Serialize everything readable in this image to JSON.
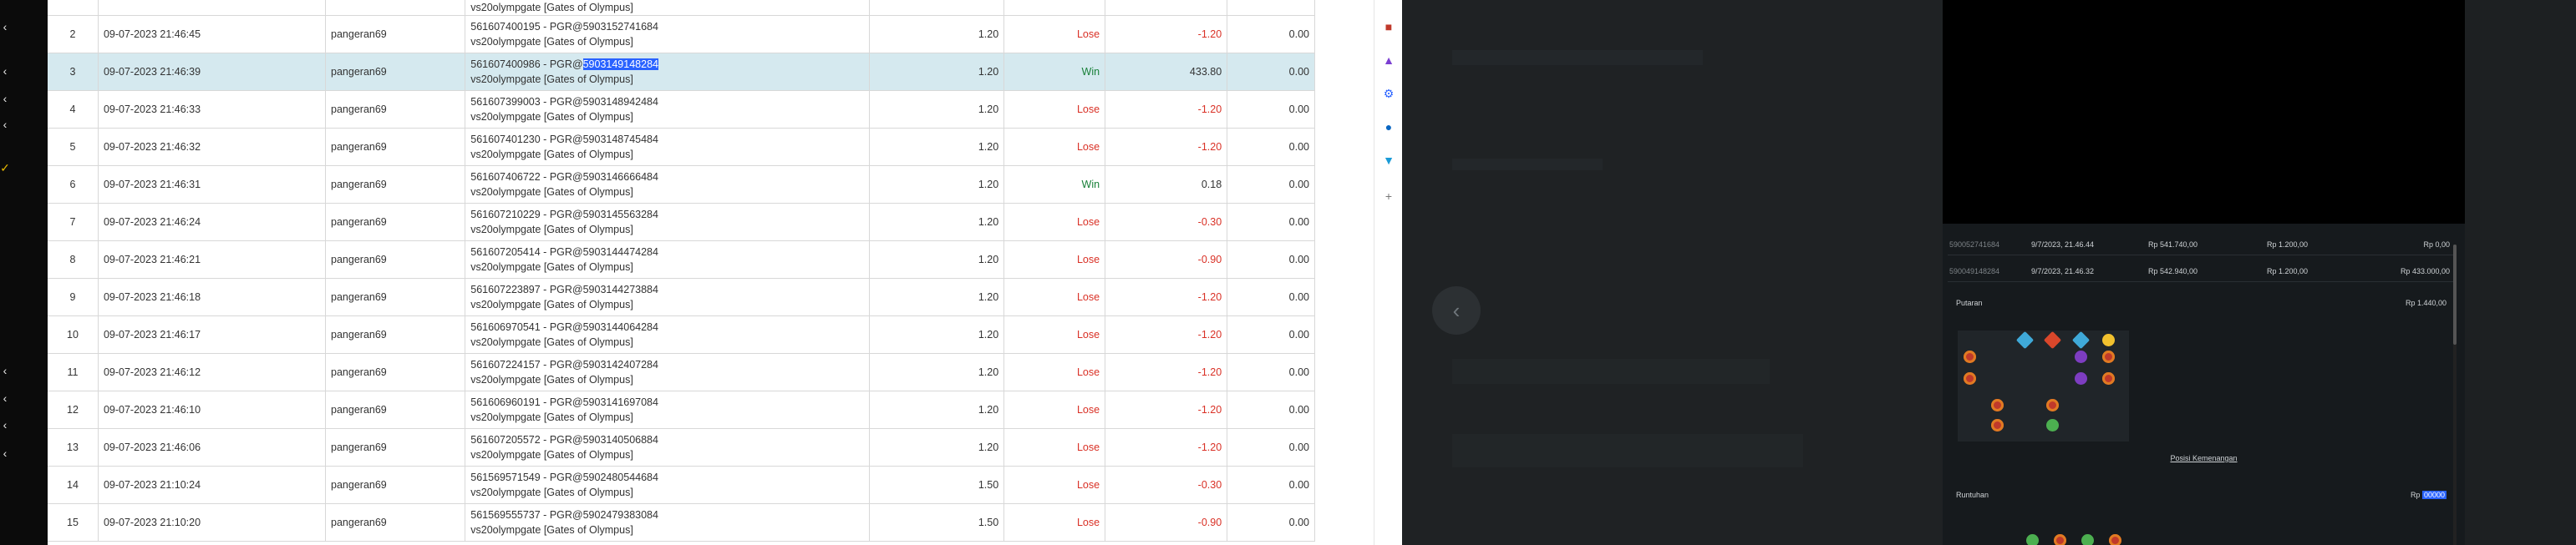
{
  "rows": [
    {
      "no": "",
      "date": "",
      "user": "",
      "game1": "vs20olympgate [Gates of Olympus]",
      "game2": "",
      "bet": "",
      "result": "",
      "win": "",
      "jp": "",
      "partial": true
    },
    {
      "no": "2",
      "date": "09-07-2023 21:46:45",
      "user": "pangeran69",
      "game1": "561607400195 - PGR@5903152741684",
      "game2": "vs20olympgate [Gates of Olympus]",
      "bet": "1.20",
      "result": "Lose",
      "win": "-1.20",
      "jp": "0.00"
    },
    {
      "no": "3",
      "date": "09-07-2023 21:46:39",
      "user": "pangeran69",
      "game1": "561607400986 - PGR@",
      "game1_hl": "5903149148284",
      "game2": "vs20olympgate [Gates of Olympus]",
      "bet": "1.20",
      "result": "Win",
      "win": "433.80",
      "jp": "0.00",
      "selected": true
    },
    {
      "no": "4",
      "date": "09-07-2023 21:46:33",
      "user": "pangeran69",
      "game1": "561607399003 - PGR@5903148942484",
      "game2": "vs20olympgate [Gates of Olympus]",
      "bet": "1.20",
      "result": "Lose",
      "win": "-1.20",
      "jp": "0.00"
    },
    {
      "no": "5",
      "date": "09-07-2023 21:46:32",
      "user": "pangeran69",
      "game1": "561607401230 - PGR@5903148745484",
      "game2": "vs20olympgate [Gates of Olympus]",
      "bet": "1.20",
      "result": "Lose",
      "win": "-1.20",
      "jp": "0.00"
    },
    {
      "no": "6",
      "date": "09-07-2023 21:46:31",
      "user": "pangeran69",
      "game1": "561607406722 - PGR@5903146666484",
      "game2": "vs20olympgate [Gates of Olympus]",
      "bet": "1.20",
      "result": "Win",
      "win": "0.18",
      "jp": "0.00"
    },
    {
      "no": "7",
      "date": "09-07-2023 21:46:24",
      "user": "pangeran69",
      "game1": "561607210229 - PGR@5903145563284",
      "game2": "vs20olympgate [Gates of Olympus]",
      "bet": "1.20",
      "result": "Lose",
      "win": "-0.30",
      "jp": "0.00"
    },
    {
      "no": "8",
      "date": "09-07-2023 21:46:21",
      "user": "pangeran69",
      "game1": "561607205414 - PGR@5903144474284",
      "game2": "vs20olympgate [Gates of Olympus]",
      "bet": "1.20",
      "result": "Lose",
      "win": "-0.90",
      "jp": "0.00"
    },
    {
      "no": "9",
      "date": "09-07-2023 21:46:18",
      "user": "pangeran69",
      "game1": "561607223897 - PGR@5903144273884",
      "game2": "vs20olympgate [Gates of Olympus]",
      "bet": "1.20",
      "result": "Lose",
      "win": "-1.20",
      "jp": "0.00"
    },
    {
      "no": "10",
      "date": "09-07-2023 21:46:17",
      "user": "pangeran69",
      "game1": "561606970541 - PGR@5903144064284",
      "game2": "vs20olympgate [Gates of Olympus]",
      "bet": "1.20",
      "result": "Lose",
      "win": "-1.20",
      "jp": "0.00"
    },
    {
      "no": "11",
      "date": "09-07-2023 21:46:12",
      "user": "pangeran69",
      "game1": "561607224157 - PGR@5903142407284",
      "game2": "vs20olympgate [Gates of Olympus]",
      "bet": "1.20",
      "result": "Lose",
      "win": "-1.20",
      "jp": "0.00"
    },
    {
      "no": "12",
      "date": "09-07-2023 21:46:10",
      "user": "pangeran69",
      "game1": "561606960191 - PGR@5903141697084",
      "game2": "vs20olympgate [Gates of Olympus]",
      "bet": "1.20",
      "result": "Lose",
      "win": "-1.20",
      "jp": "0.00"
    },
    {
      "no": "13",
      "date": "09-07-2023 21:46:06",
      "user": "pangeran69",
      "game1": "561607205572 - PGR@5903140506884",
      "game2": "vs20olympgate [Gates of Olympus]",
      "bet": "1.20",
      "result": "Lose",
      "win": "-1.20",
      "jp": "0.00"
    },
    {
      "no": "14",
      "date": "09-07-2023 21:10:24",
      "user": "pangeran69",
      "game1": "561569571549 - PGR@5902480544684",
      "game2": "vs20olympgate [Gates of Olympus]",
      "bet": "1.50",
      "result": "Lose",
      "win": "-0.30",
      "jp": "0.00"
    },
    {
      "no": "15",
      "date": "09-07-2023 21:10:20",
      "user": "pangeran69",
      "game1": "561569555737 - PGR@5902479383084",
      "game2": "vs20olympgate [Gates of Olympus]",
      "bet": "1.50",
      "result": "Lose",
      "win": "-0.90",
      "jp": "0.00"
    }
  ],
  "history": [
    {
      "id": "590052741684",
      "date": "9/7/2023, 21.46.44",
      "balance": "Rp 541.740,00",
      "bet": "Rp 1.200,00",
      "win": "Rp 0,00"
    },
    {
      "id": "590049148284",
      "date": "9/7/2023, 21.46.32",
      "balance": "Rp 542.940,00",
      "bet": "Rp 1.200,00",
      "win": "Rp 433.000,00"
    }
  ],
  "popup": {
    "putaran_label": "Putaran",
    "putaran_value": "Rp 1.440,00",
    "paytable_link": "Posisi Kemenangan",
    "runtuhan_label": "Runtuhan",
    "runtuhan_prefix": "Rp",
    "runtuhan_value": "00000"
  },
  "rail_icons": [
    "chevron-left",
    "chevron-left",
    "chevron-left",
    "chevron-left",
    "check",
    "chevron-left",
    "chevron-left",
    "chevron-left",
    "chevron-left"
  ],
  "ext_icons": [
    "gift-icon",
    "puzzle-icon",
    "gear-icon",
    "outlook-icon",
    "cart-icon",
    "plus-icon"
  ],
  "nav": {
    "back_glyph": "‹"
  }
}
